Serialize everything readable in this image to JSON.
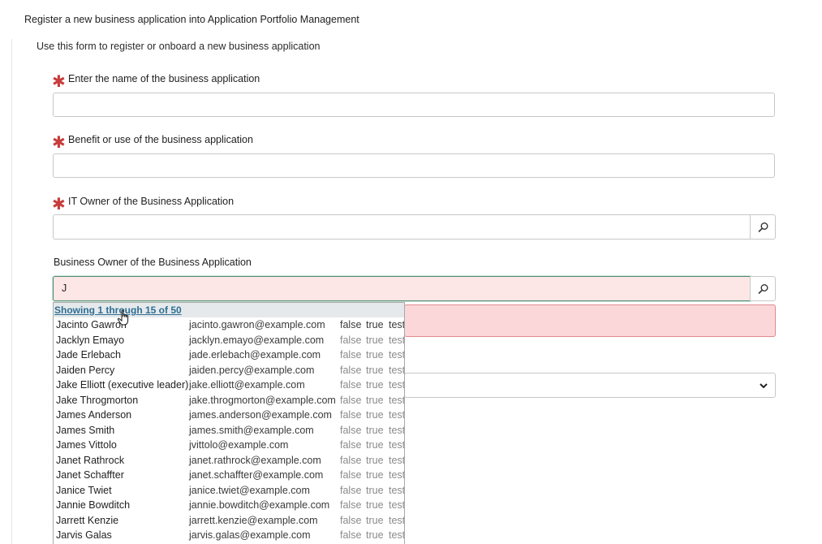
{
  "form": {
    "title": "Register a new business application into Application Portfolio Management",
    "description": "Use this form to register or onboard a new business application"
  },
  "fields": {
    "name": {
      "label": "Enter the name of the business application",
      "required": true,
      "value": ""
    },
    "benefit": {
      "label": "Benefit or use of the business application",
      "required": true,
      "value": ""
    },
    "it_owner": {
      "label": "IT Owner of the Business Application",
      "required": true,
      "value": ""
    },
    "business_owner": {
      "label": "Business Owner of the Business Application",
      "required": false,
      "value": "J"
    }
  },
  "icons": {
    "required": "asterisk-icon",
    "lookup": "search-icon",
    "select": "chevron-down-icon",
    "cursor": "hand-pointer-icon"
  },
  "colors": {
    "required_star": "#c83c3c",
    "active_input_bg": "#fde6e6",
    "active_input_border": "#4f8b6f",
    "error_bg": "#fcd7d9",
    "link": "#2e6e94"
  },
  "autocomplete": {
    "header": "Showing 1 through 15 of 50",
    "rows": [
      {
        "name": "Jacinto Gawron",
        "email": "jacinto.gawron@example.com",
        "c1": "false",
        "c2": "true",
        "c3": "test"
      },
      {
        "name": "Jacklyn Emayo",
        "email": "jacklyn.emayo@example.com",
        "c1": "false",
        "c2": "true",
        "c3": "test"
      },
      {
        "name": "Jade Erlebach",
        "email": "jade.erlebach@example.com",
        "c1": "false",
        "c2": "true",
        "c3": "test"
      },
      {
        "name": "Jaiden Percy",
        "email": "jaiden.percy@example.com",
        "c1": "false",
        "c2": "true",
        "c3": "test"
      },
      {
        "name": "Jake Elliott (executive leader)",
        "email": "jake.elliott@example.com",
        "c1": "false",
        "c2": "true",
        "c3": "test"
      },
      {
        "name": "Jake Throgmorton",
        "email": "jake.throgmorton@example.com",
        "c1": "false",
        "c2": "true",
        "c3": "test"
      },
      {
        "name": "James Anderson",
        "email": "james.anderson@example.com",
        "c1": "false",
        "c2": "true",
        "c3": "test"
      },
      {
        "name": "James Smith",
        "email": "james.smith@example.com",
        "c1": "false",
        "c2": "true",
        "c3": "test"
      },
      {
        "name": "James Vittolo",
        "email": "jvittolo@example.com",
        "c1": "false",
        "c2": "true",
        "c3": "test"
      },
      {
        "name": "Janet Rathrock",
        "email": "janet.rathrock@example.com",
        "c1": "false",
        "c2": "true",
        "c3": "test"
      },
      {
        "name": "Janet Schaffter",
        "email": "janet.schaffter@example.com",
        "c1": "false",
        "c2": "true",
        "c3": "test"
      },
      {
        "name": "Janice Twiet",
        "email": "janice.twiet@example.com",
        "c1": "false",
        "c2": "true",
        "c3": "test"
      },
      {
        "name": "Jannie Bowditch",
        "email": "jannie.bowditch@example.com",
        "c1": "false",
        "c2": "true",
        "c3": "test"
      },
      {
        "name": "Jarrett Kenzie",
        "email": "jarrett.kenzie@example.com",
        "c1": "false",
        "c2": "true",
        "c3": "test"
      },
      {
        "name": "Jarvis Galas",
        "email": "jarvis.galas@example.com",
        "c1": "false",
        "c2": "true",
        "c3": "test"
      }
    ]
  }
}
